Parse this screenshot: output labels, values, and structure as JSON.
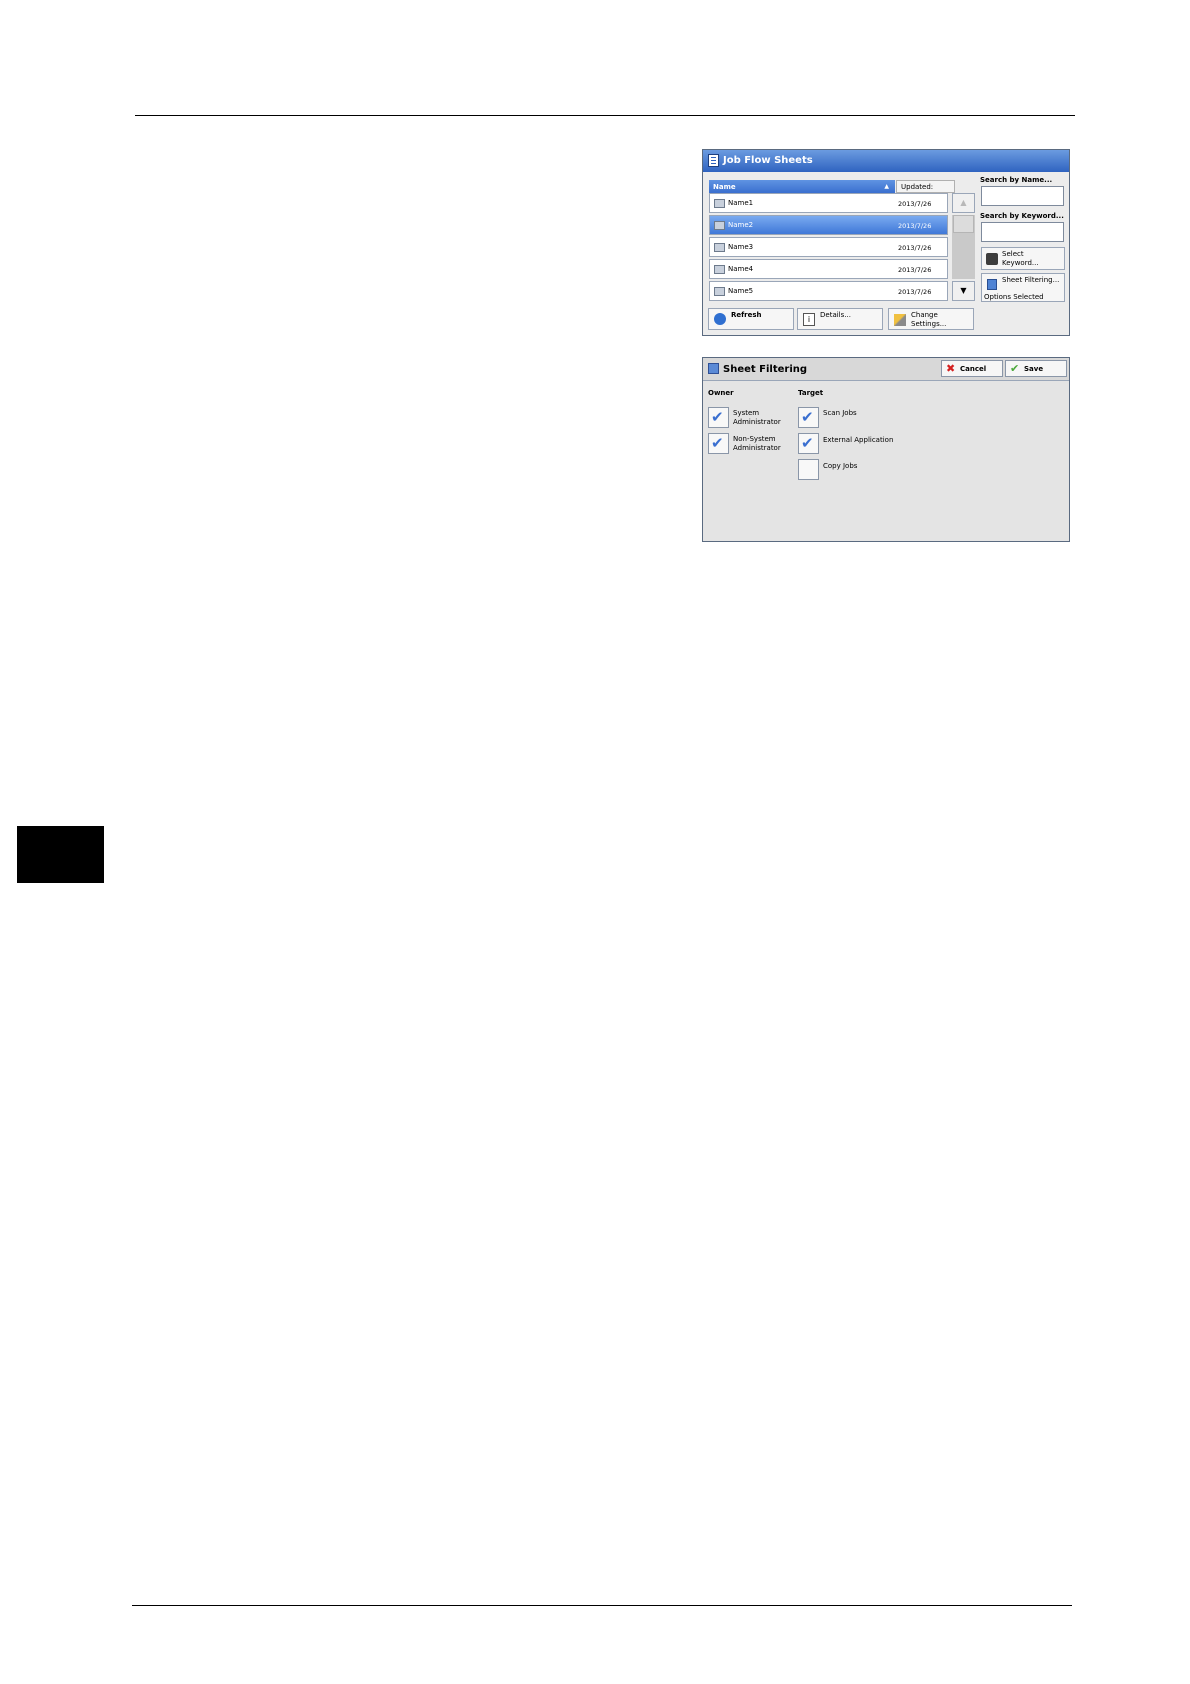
{
  "job_flow": {
    "title": "Job Flow Sheets",
    "list_header": {
      "name": "Name",
      "updated": "Updated:"
    },
    "rows": [
      {
        "name": "Name1",
        "date": "2013/7/26"
      },
      {
        "name": "Name2",
        "date": "2013/7/26",
        "selected": true
      },
      {
        "name": "Name3",
        "date": "2013/7/26"
      },
      {
        "name": "Name4",
        "date": "2013/7/26"
      },
      {
        "name": "Name5",
        "date": "2013/7/26"
      }
    ],
    "scroll_up": "▲",
    "scroll_down": "▼",
    "search_name_label": "Search by Name...",
    "search_keyword_label": "Search by Keyword...",
    "select_keyword": {
      "line1": "Select",
      "line2": "Keyword..."
    },
    "sheet_filtering": {
      "line1": "Sheet Filtering...",
      "status": "Options Selected"
    },
    "refresh_label": "Refresh",
    "details_label": "Details...",
    "change_settings": {
      "line1": "Change",
      "line2": "Settings..."
    }
  },
  "sheet_filtering": {
    "title": "Sheet Filtering",
    "cancel_label": "Cancel",
    "save_label": "Save",
    "owner_label": "Owner",
    "target_label": "Target",
    "owner_options": [
      {
        "line1": "System",
        "line2": "Administrator",
        "checked": true
      },
      {
        "line1": "Non-System",
        "line2": "Administrator",
        "checked": true
      }
    ],
    "target_options": [
      {
        "label": "Scan Jobs",
        "checked": true
      },
      {
        "label": "External Application",
        "checked": true
      },
      {
        "label": "Copy Jobs",
        "checked": false
      }
    ]
  }
}
